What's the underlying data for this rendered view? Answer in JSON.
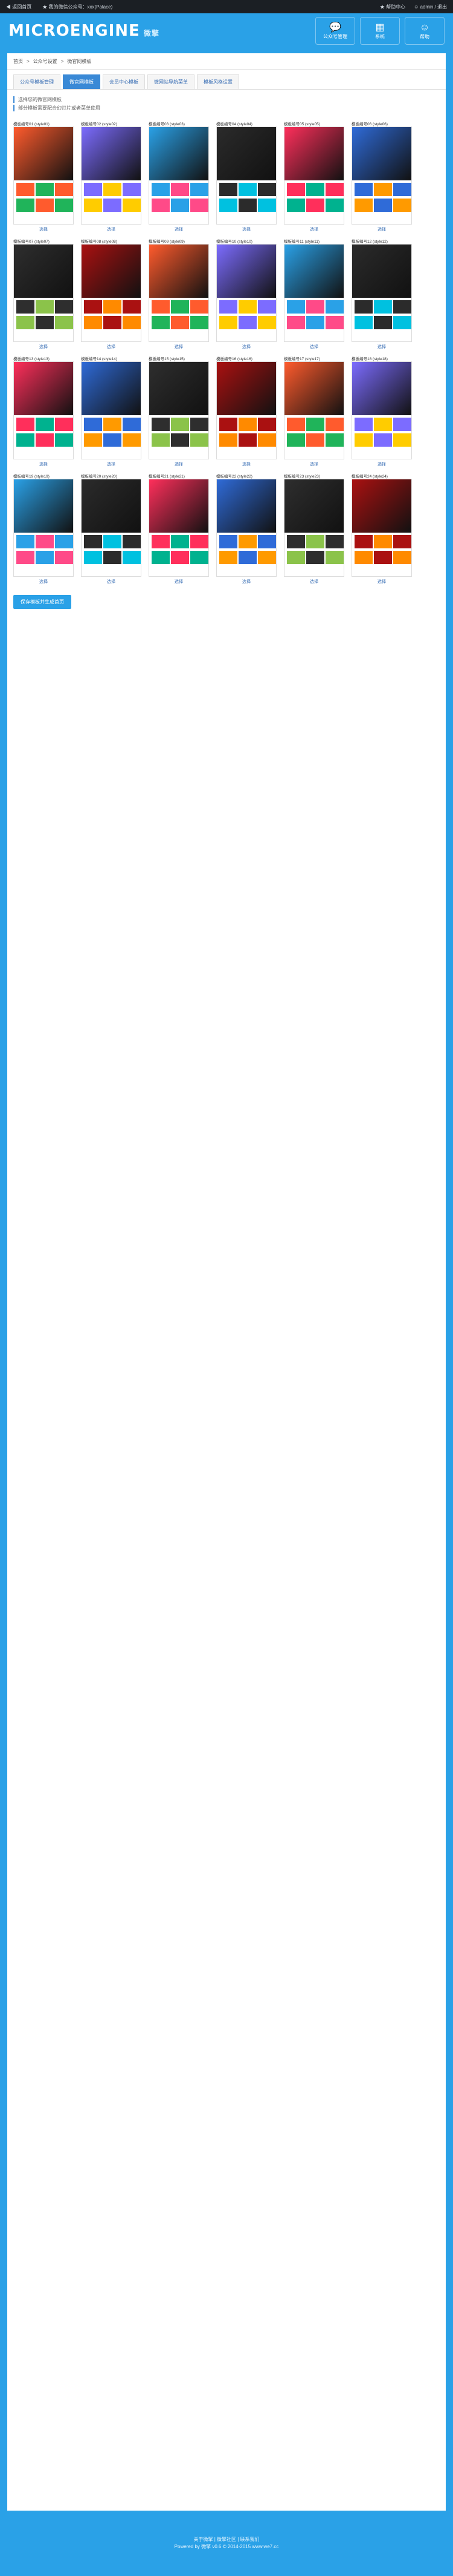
{
  "topbar": {
    "left1": "◀ 返回首页",
    "left2": "★ 我的微信公众号：xxx(Palace)",
    "right1": "★ 帮助中心",
    "right2": "☺ admin / 退出"
  },
  "header": {
    "logo": "MICROENGINE",
    "logo_cn": "微擎",
    "nav": [
      {
        "icon": "💬",
        "label": "公众号管理"
      },
      {
        "icon": "▦",
        "label": "系统"
      },
      {
        "icon": "☺",
        "label": "帮助"
      }
    ]
  },
  "breadcrumb": [
    "首页",
    "公众号设置",
    "微官网模板"
  ],
  "tabs": [
    "公众号模板管理",
    "微官网模板",
    "会员中心模板",
    "微网站导航菜单",
    "模板风格设置"
  ],
  "tips": [
    "选择您的微官网模板",
    "部分模板需要配合幻灯片或者菜单使用"
  ],
  "cards": [
    "模板编号01 (style01)",
    "模板编号02 (style02)",
    "模板编号03 (style03)",
    "模板编号04 (style04)",
    "模板编号05 (style05)",
    "模板编号06 (style06)",
    "模板编号07 (style07)",
    "模板编号08 (style08)",
    "模板编号09 (style09)",
    "模板编号10 (style10)",
    "模板编号11 (style11)",
    "模板编号12 (style12)",
    "模板编号13 (style13)",
    "模板编号14 (style14)",
    "模板编号15 (style15)",
    "模板编号16 (style16)",
    "模板编号17 (style17)",
    "模板编号18 (style18)",
    "模板编号19 (style19)",
    "模板编号20 (style20)",
    "模板编号21 (style21)",
    "模板编号22 (style22)",
    "模板编号23 (style23)",
    "模板编号24 (style24)"
  ],
  "use_label": "选择",
  "more_button": "保存模板并生成首页",
  "footer": [
    "关于微擎 | 微擎社区 | 联系我们",
    "Powered by 微擎 v0.6 © 2014-2015 www.we7.cc"
  ]
}
